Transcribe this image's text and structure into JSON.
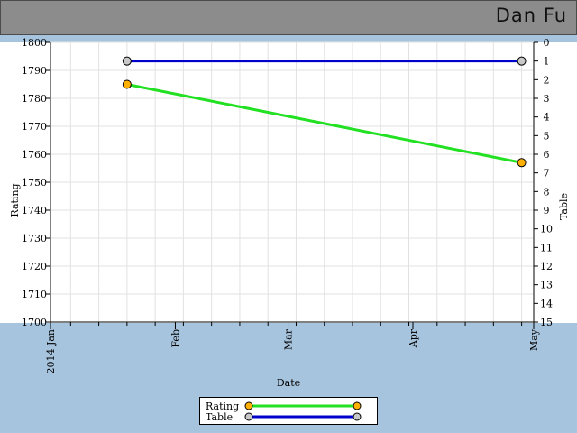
{
  "header": {
    "user_name": "Dan Fu"
  },
  "colors": {
    "page_background": "#a7c4de",
    "header_background": "#8c8c8c",
    "rating_line": "#22e022",
    "rating_marker": "#ffb000",
    "table_line": "#0000cc",
    "table_marker": "#c8c8c8"
  },
  "chart_data": {
    "type": "line",
    "xlabel": "Date",
    "ylabel": "Rating",
    "y2label": "Table",
    "x_ticks": [
      "2014 Jan",
      "Feb",
      "Mar",
      "Apr",
      "May"
    ],
    "xlim": [
      "2014-01-01",
      "2014-05-01"
    ],
    "ylim": [
      1700,
      1800
    ],
    "y_ticks": [
      1700,
      1710,
      1720,
      1730,
      1740,
      1750,
      1760,
      1770,
      1780,
      1790,
      1800
    ],
    "y2lim": [
      15,
      0
    ],
    "y2_reversed": true,
    "y2_ticks": [
      0,
      1,
      2,
      3,
      4,
      5,
      6,
      7,
      8,
      9,
      10,
      11,
      12,
      13,
      14,
      15
    ],
    "grid": true,
    "legend_position": "bottom",
    "series": [
      {
        "name": "Rating",
        "axis": "left",
        "x": [
          "2014-01-20",
          "2014-04-28"
        ],
        "y": [
          1785,
          1757
        ]
      },
      {
        "name": "Table",
        "axis": "right",
        "x": [
          "2014-01-20",
          "2014-04-28"
        ],
        "y": [
          1,
          1
        ]
      }
    ]
  }
}
